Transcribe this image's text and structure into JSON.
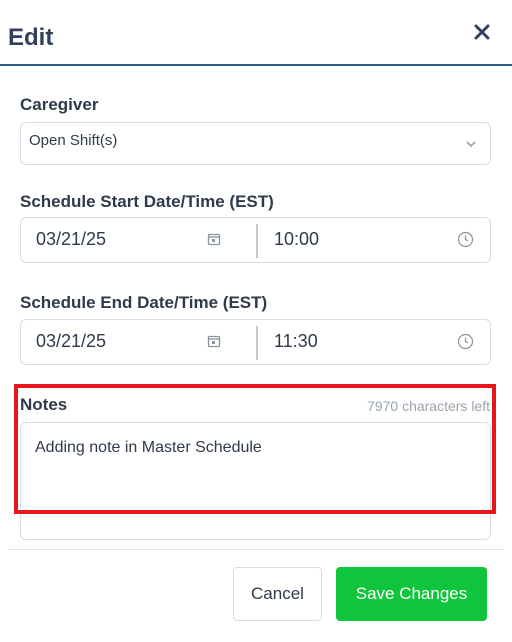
{
  "modal": {
    "title": "Edit",
    "close_icon": "close-icon"
  },
  "caregiver": {
    "label": "Caregiver",
    "value": "Open Shift(s)",
    "icon": "chevron-down-icon"
  },
  "schedule_start": {
    "label": "Schedule Start Date/Time (EST)",
    "date": "03/21/25",
    "time": "10:00",
    "date_icon": "calendar-icon",
    "time_icon": "clock-icon"
  },
  "schedule_end": {
    "label": "Schedule End Date/Time (EST)",
    "date": "03/21/25",
    "time": "11:30",
    "date_icon": "calendar-icon",
    "time_icon": "clock-icon"
  },
  "notes": {
    "label": "Notes",
    "chars_left": "7970 characters left",
    "value": "Adding note in Master Schedule"
  },
  "footer": {
    "cancel_label": "Cancel",
    "save_label": "Save Changes"
  },
  "colors": {
    "accent_line": "#2c5d86",
    "highlight": "#e6161d",
    "save_button": "#10c43c"
  }
}
